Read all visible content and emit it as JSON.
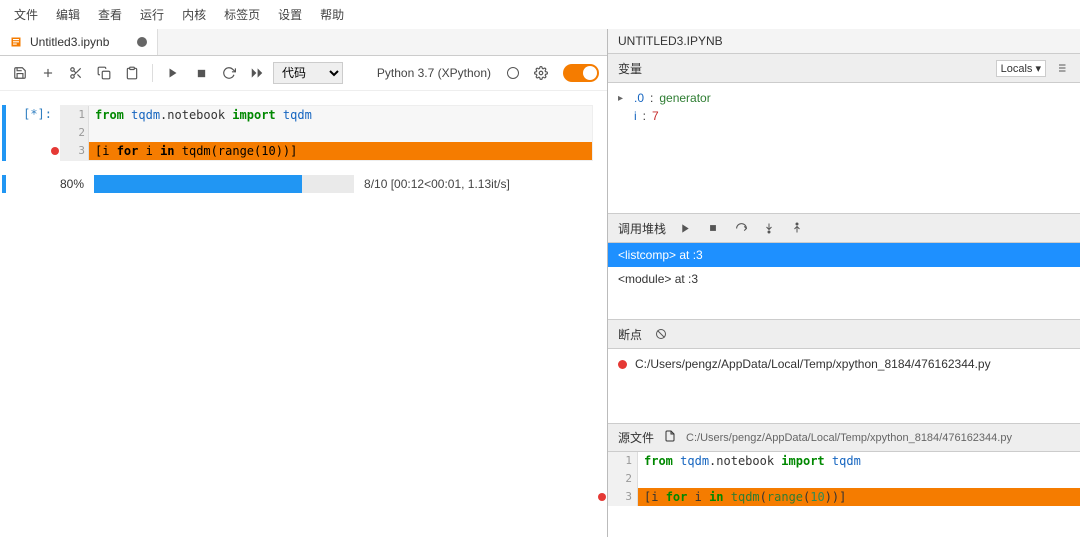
{
  "menubar": [
    "文件",
    "编辑",
    "查看",
    "运行",
    "内核",
    "标签页",
    "设置",
    "帮助"
  ],
  "tab": {
    "name": "Untitled3.ipynb",
    "dirty": true
  },
  "toolbar": {
    "cell_type": "代码"
  },
  "kernel": {
    "label": "Python 3.7 (XPython)"
  },
  "cell": {
    "prompt": "[*]:",
    "lines": [
      {
        "n": "1",
        "tokens": [
          [
            "kw",
            "from"
          ],
          [
            "sp",
            " "
          ],
          [
            "mod",
            "tqdm"
          ],
          [
            "txt",
            ".notebook "
          ],
          [
            "kw",
            "import"
          ],
          [
            "sp",
            " "
          ],
          [
            "mod",
            "tqdm"
          ]
        ]
      },
      {
        "n": "2",
        "tokens": []
      },
      {
        "n": "3",
        "hl": true,
        "bp": true,
        "tokens": [
          [
            "txt",
            "[i "
          ],
          [
            "kw",
            "for"
          ],
          [
            "txt",
            " i "
          ],
          [
            "kw",
            "in"
          ],
          [
            "txt",
            " "
          ],
          [
            "fn",
            "tqdm"
          ],
          [
            "txt",
            "("
          ],
          [
            "fn",
            "range"
          ],
          [
            "txt",
            "("
          ],
          [
            "num",
            "10"
          ],
          [
            "txt",
            "))]"
          ]
        ]
      }
    ]
  },
  "progress": {
    "pct_label": "80%",
    "pct": 80,
    "text": "8/10 [00:12<00:01, 1.13it/s]"
  },
  "debugger": {
    "title": "UNTITLED3.IPYNB",
    "vars_label": "变量",
    "scope": "Locals",
    "vars": [
      {
        "caret": true,
        "name": ".0",
        "sep": ": ",
        "type": "generator"
      },
      {
        "caret": false,
        "name": "i",
        "sep": ": ",
        "val": "7"
      }
    ],
    "callstack_label": "调用堆栈",
    "callstack": [
      {
        "text": "<listcomp> at :3",
        "selected": true
      },
      {
        "text": "<module> at :3",
        "selected": false
      }
    ],
    "bp_label": "断点",
    "bp_path": "C:/Users/pengz/AppData/Local/Temp/xpython_8184/476162344.py",
    "src_label": "源文件",
    "src_path": "C:/Users/pengz/AppData/Local/Temp/xpython_8184/476162344.py",
    "src_lines": [
      {
        "n": "1",
        "tokens": [
          [
            "kw",
            "from"
          ],
          [
            "sp",
            " "
          ],
          [
            "mod",
            "tqdm"
          ],
          [
            "txt",
            ".notebook "
          ],
          [
            "kw",
            "import"
          ],
          [
            "sp",
            " "
          ],
          [
            "mod",
            "tqdm"
          ]
        ]
      },
      {
        "n": "2",
        "tokens": []
      },
      {
        "n": "3",
        "hl": true,
        "bp": true,
        "tokens": [
          [
            "txt",
            "[i "
          ],
          [
            "kw",
            "for"
          ],
          [
            "txt",
            " i "
          ],
          [
            "kw",
            "in"
          ],
          [
            "txt",
            " "
          ],
          [
            "fn",
            "tqdm"
          ],
          [
            "txt",
            "("
          ],
          [
            "fn",
            "range"
          ],
          [
            "txt",
            "("
          ],
          [
            "num",
            "10"
          ],
          [
            "txt",
            "))]"
          ]
        ]
      }
    ]
  }
}
